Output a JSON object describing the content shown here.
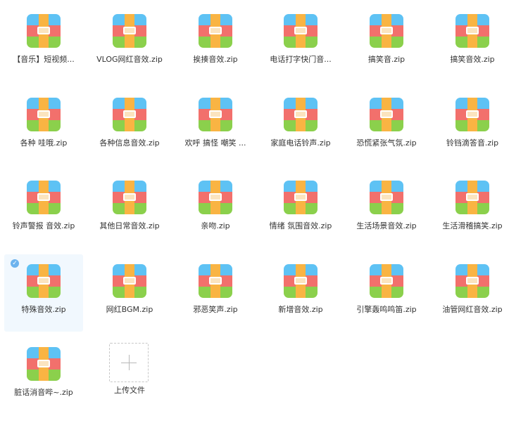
{
  "files": [
    {
      "name": "【音乐】短视频..."
    },
    {
      "name": "VLOG网红音效.zip"
    },
    {
      "name": "挨揍音效.zip"
    },
    {
      "name": "电话打字快门音..."
    },
    {
      "name": "搞笑音.zip"
    },
    {
      "name": "搞笑音效.zip"
    },
    {
      "name": "各种 哇哦.zip"
    },
    {
      "name": "各种信息音效.zip"
    },
    {
      "name": "欢呼 搞怪 嘲笑 ..."
    },
    {
      "name": "家庭电话铃声.zip"
    },
    {
      "name": "恐慌紧张气氛.zip"
    },
    {
      "name": "铃铛滴答音.zip"
    },
    {
      "name": "铃声警报 音效.zip"
    },
    {
      "name": "其他日常音效.zip"
    },
    {
      "name": "亲吻.zip"
    },
    {
      "name": "情绪 氛围音效.zip"
    },
    {
      "name": "生活场景音效.zip"
    },
    {
      "name": "生活滑稽搞笑.zip"
    },
    {
      "name": "特殊音效.zip",
      "selected": true
    },
    {
      "name": "网红BGM.zip"
    },
    {
      "name": "邪恶笑声.zip"
    },
    {
      "name": "新增音效.zip"
    },
    {
      "name": "引擎轰鸣鸣笛.zip"
    },
    {
      "name": "油管网红音效.zip"
    },
    {
      "name": "脏话消音哔~.zip"
    }
  ],
  "upload": {
    "label": "上传文件"
  },
  "icons": {
    "file": "zip-archive-icon",
    "selected": "check-icon",
    "upload": "plus-icon"
  },
  "colors": {
    "zip_top": "#5ec2f4",
    "zip_middle": "#f2706c",
    "zip_bottom": "#8bd04c",
    "zip_strap": "#f9b443",
    "selection_background": "#f1f8fe",
    "check_badge": "#6cb3ee"
  }
}
